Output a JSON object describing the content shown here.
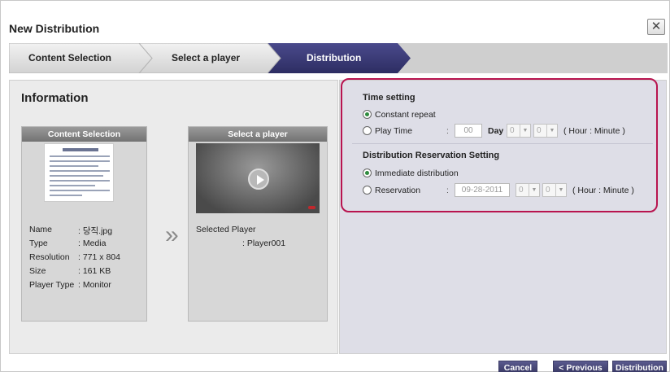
{
  "dialog": {
    "title": "New Distribution",
    "close_glyph": "✕"
  },
  "steps": [
    {
      "label": "Content Selection",
      "active": false
    },
    {
      "label": "Select a player",
      "active": false
    },
    {
      "label": "Distribution",
      "active": true
    }
  ],
  "left": {
    "title": "Information",
    "content_card": {
      "header": "Content Selection",
      "meta": [
        {
          "key": "Name",
          "value": ": 당직.jpg"
        },
        {
          "key": "Type",
          "value": ": Media"
        },
        {
          "key": "Resolution",
          "value": ": 771 x 804"
        },
        {
          "key": "Size",
          "value": ": 161 KB"
        },
        {
          "key": "Player Type",
          "value": ": Monitor"
        }
      ]
    },
    "chevron_glyph": "»",
    "player_card": {
      "header": "Select a player",
      "selected_label": "Selected Player",
      "selected_value": ": Player001"
    }
  },
  "right": {
    "time_setting": {
      "title": "Time setting",
      "options": [
        "Constant repeat",
        "Play Time"
      ],
      "selected": 0,
      "play_time_value": "00",
      "day_label": "Day",
      "hour_value": "0",
      "minute_value": "0",
      "unit": "( Hour : Minute )"
    },
    "reservation_setting": {
      "title": "Distribution Reservation Setting",
      "options": [
        "Immediate distribution",
        "Reservation"
      ],
      "selected": 0,
      "date_value": "09-28-2011",
      "hour_value": "0",
      "minute_value": "0",
      "unit": "( Hour : Minute )"
    },
    "colon": ":"
  },
  "footer": {
    "cancel": "Cancel",
    "previous": "< Previous",
    "distribution": "Distribution"
  },
  "colors": {
    "accent_active_step": "#3a3a78",
    "highlight_border": "#b8144f",
    "button_bg": "#3e3e6c"
  },
  "icons": {
    "close": "close-icon",
    "play": "play-icon",
    "chevron": "double-chevron-right-icon"
  }
}
